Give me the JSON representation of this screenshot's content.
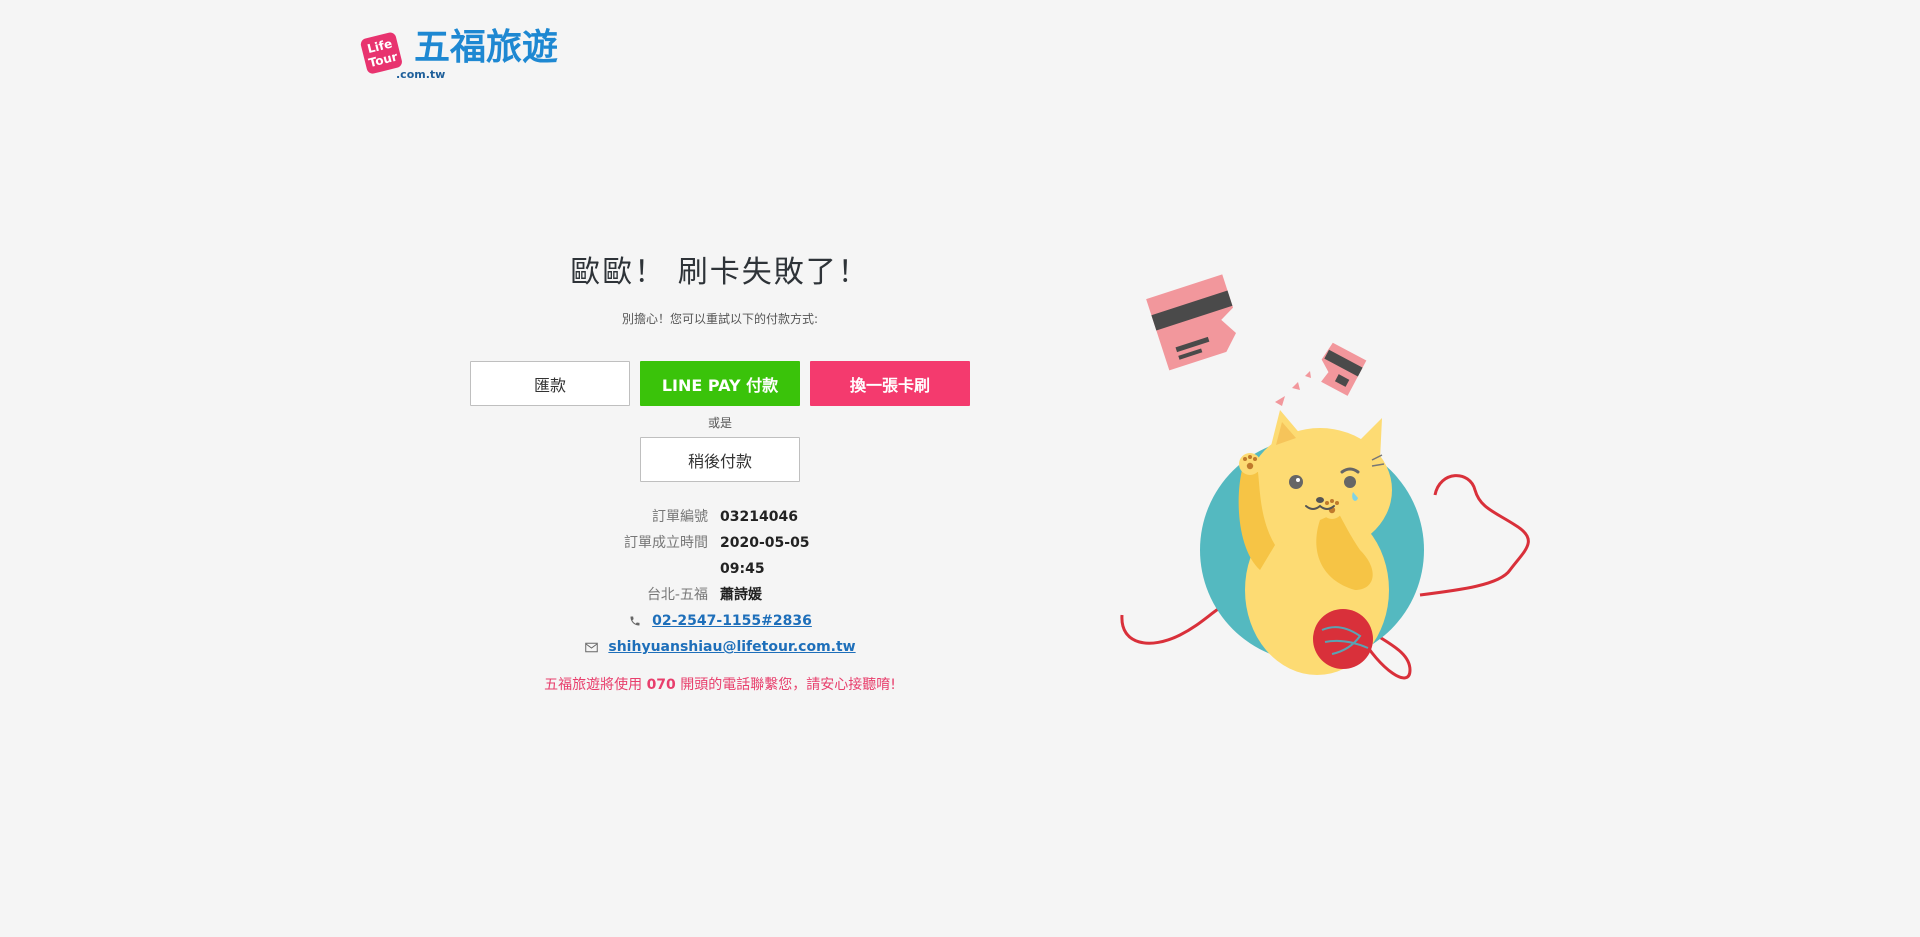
{
  "logo": {
    "badge_line1": "Life",
    "badge_line2": "Tour",
    "title": "五福旅遊",
    "domain": ".com.tw"
  },
  "headline": "歐歐！ 刷卡失敗了！",
  "subline": "別擔心！您可以重試以下的付款方式:",
  "buttons": {
    "remit": "匯款",
    "linepay": "LINE PAY 付款",
    "change_card": "換一張卡刷",
    "or_text": "或是",
    "pay_later": "稍後付款"
  },
  "order": {
    "number_label": "訂單編號",
    "number_value": "03214046",
    "time_label": "訂單成立時間",
    "time_value": "2020-05-05 09:45",
    "branch_label": "台北-五福",
    "agent_name": "蕭詩媛",
    "phone": "02-2547-1155#2836",
    "email": "shihyuanshiau@lifetour.com.tw"
  },
  "notice": {
    "prefix": "五福旅遊將使用",
    "highlight": "070",
    "suffix": "開頭的電話聯繫您，請安心接聽唷!"
  },
  "colors": {
    "brand_blue": "#1e88d2",
    "brand_pink": "#e8336f",
    "line_green": "#3ac30a",
    "change_pink": "#f43a6e",
    "notice_red": "#e83e6c",
    "link_blue": "#1e6fba"
  },
  "icons": {
    "phone": "phone-icon",
    "email": "mail-icon"
  }
}
